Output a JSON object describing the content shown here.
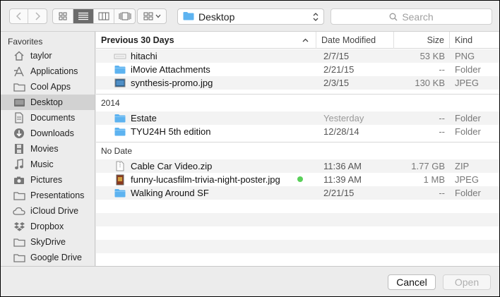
{
  "toolbar": {
    "location": "Desktop",
    "search_placeholder": "Search"
  },
  "sidebar": {
    "heading": "Favorites",
    "items": [
      {
        "label": "taylor",
        "icon": "home-icon"
      },
      {
        "label": "Applications",
        "icon": "applications-icon"
      },
      {
        "label": "Cool Apps",
        "icon": "folder-icon"
      },
      {
        "label": "Desktop",
        "icon": "desktop-icon",
        "selected": true
      },
      {
        "label": "Documents",
        "icon": "documents-icon"
      },
      {
        "label": "Downloads",
        "icon": "downloads-icon"
      },
      {
        "label": "Movies",
        "icon": "movies-icon"
      },
      {
        "label": "Music",
        "icon": "music-icon"
      },
      {
        "label": "Pictures",
        "icon": "pictures-icon"
      },
      {
        "label": "Presentations",
        "icon": "folder-icon"
      },
      {
        "label": "iCloud Drive",
        "icon": "cloud-icon"
      },
      {
        "label": "Dropbox",
        "icon": "dropbox-icon"
      },
      {
        "label": "SkyDrive",
        "icon": "folder-icon"
      },
      {
        "label": "Google Drive",
        "icon": "folder-icon"
      }
    ]
  },
  "columns": {
    "name": "Previous 30 Days",
    "date": "Date Modified",
    "size": "Size",
    "kind": "Kind"
  },
  "groups": [
    {
      "label": "Previous 30 Days",
      "files": [
        {
          "name": "hitachi",
          "date": "2/7/15",
          "size": "53 KB",
          "kind": "PNG",
          "icon": "image-file-icon"
        },
        {
          "name": "iMovie Attachments",
          "date": "2/21/15",
          "size": "--",
          "kind": "Folder",
          "icon": "folder-icon"
        },
        {
          "name": "synthesis-promo.jpg",
          "date": "2/3/15",
          "size": "130 KB",
          "kind": "JPEG",
          "icon": "image-file-icon"
        }
      ]
    },
    {
      "label": "2014",
      "files": [
        {
          "name": "Estate",
          "date": "Yesterday",
          "size": "--",
          "kind": "Folder",
          "icon": "folder-icon"
        },
        {
          "name": "TYU24H 5th edition",
          "date": "12/28/14",
          "size": "--",
          "kind": "Folder",
          "icon": "folder-icon"
        }
      ]
    },
    {
      "label": "No Date",
      "files": [
        {
          "name": "Cable Car Video.zip",
          "date": "11:36 AM",
          "size": "1.77 GB",
          "kind": "ZIP",
          "icon": "zip-file-icon"
        },
        {
          "name": "funny-lucasfilm-trivia-night-poster.jpg",
          "date": "11:39 AM",
          "size": "1 MB",
          "kind": "JPEG",
          "icon": "image-file-icon",
          "tag": "green"
        },
        {
          "name": "Walking Around SF",
          "date": "2/21/15",
          "size": "--",
          "kind": "Folder",
          "icon": "folder-icon"
        }
      ]
    }
  ],
  "footer": {
    "cancel_label": "Cancel",
    "open_label": "Open"
  },
  "colors": {
    "folder": "#5db3f0",
    "tag_green": "#5ad05a",
    "selected_sidebar": "#d2d2d2"
  }
}
